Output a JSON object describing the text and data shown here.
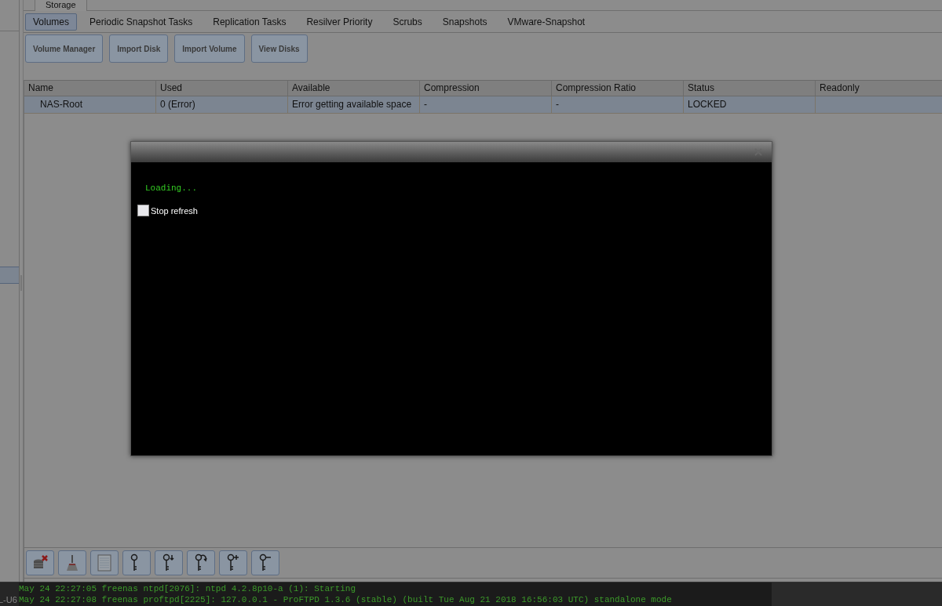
{
  "top_tab": {
    "label": "Storage"
  },
  "sub_tabs": [
    {
      "label": "Volumes",
      "selected": true
    },
    {
      "label": "Periodic Snapshot Tasks",
      "selected": false
    },
    {
      "label": "Replication Tasks",
      "selected": false
    },
    {
      "label": "Resilver Priority",
      "selected": false
    },
    {
      "label": "Scrubs",
      "selected": false
    },
    {
      "label": "Snapshots",
      "selected": false
    },
    {
      "label": "VMware-Snapshot",
      "selected": false
    }
  ],
  "buttons": [
    "Volume Manager",
    "Import Disk",
    "Import Volume",
    "View Disks"
  ],
  "table": {
    "columns": [
      "Name",
      "Used",
      "Available",
      "Compression",
      "Compression Ratio",
      "Status",
      "Readonly"
    ],
    "rows": [
      {
        "selected": true,
        "cells": [
          "NAS-Root",
          "0 (Error)",
          "Error getting available space",
          "-",
          "-",
          "LOCKED",
          ""
        ]
      }
    ]
  },
  "dialog": {
    "message": "Loading...",
    "checkbox": {
      "label": "Stop refresh",
      "checked": false
    }
  },
  "sidebar_text": "L-U6",
  "console": [
    "May 24 22:27:05 freenas ntpd[2076]: ntpd 4.2.8p10-a (1): Starting",
    "May 24 22:27:08 freenas proftpd[2225]: 127.0.0.1 - ProFTPD 1.3.6 (stable) (built Tue Aug 21 2018 16:56:03 UTC) standalone mode"
  ]
}
